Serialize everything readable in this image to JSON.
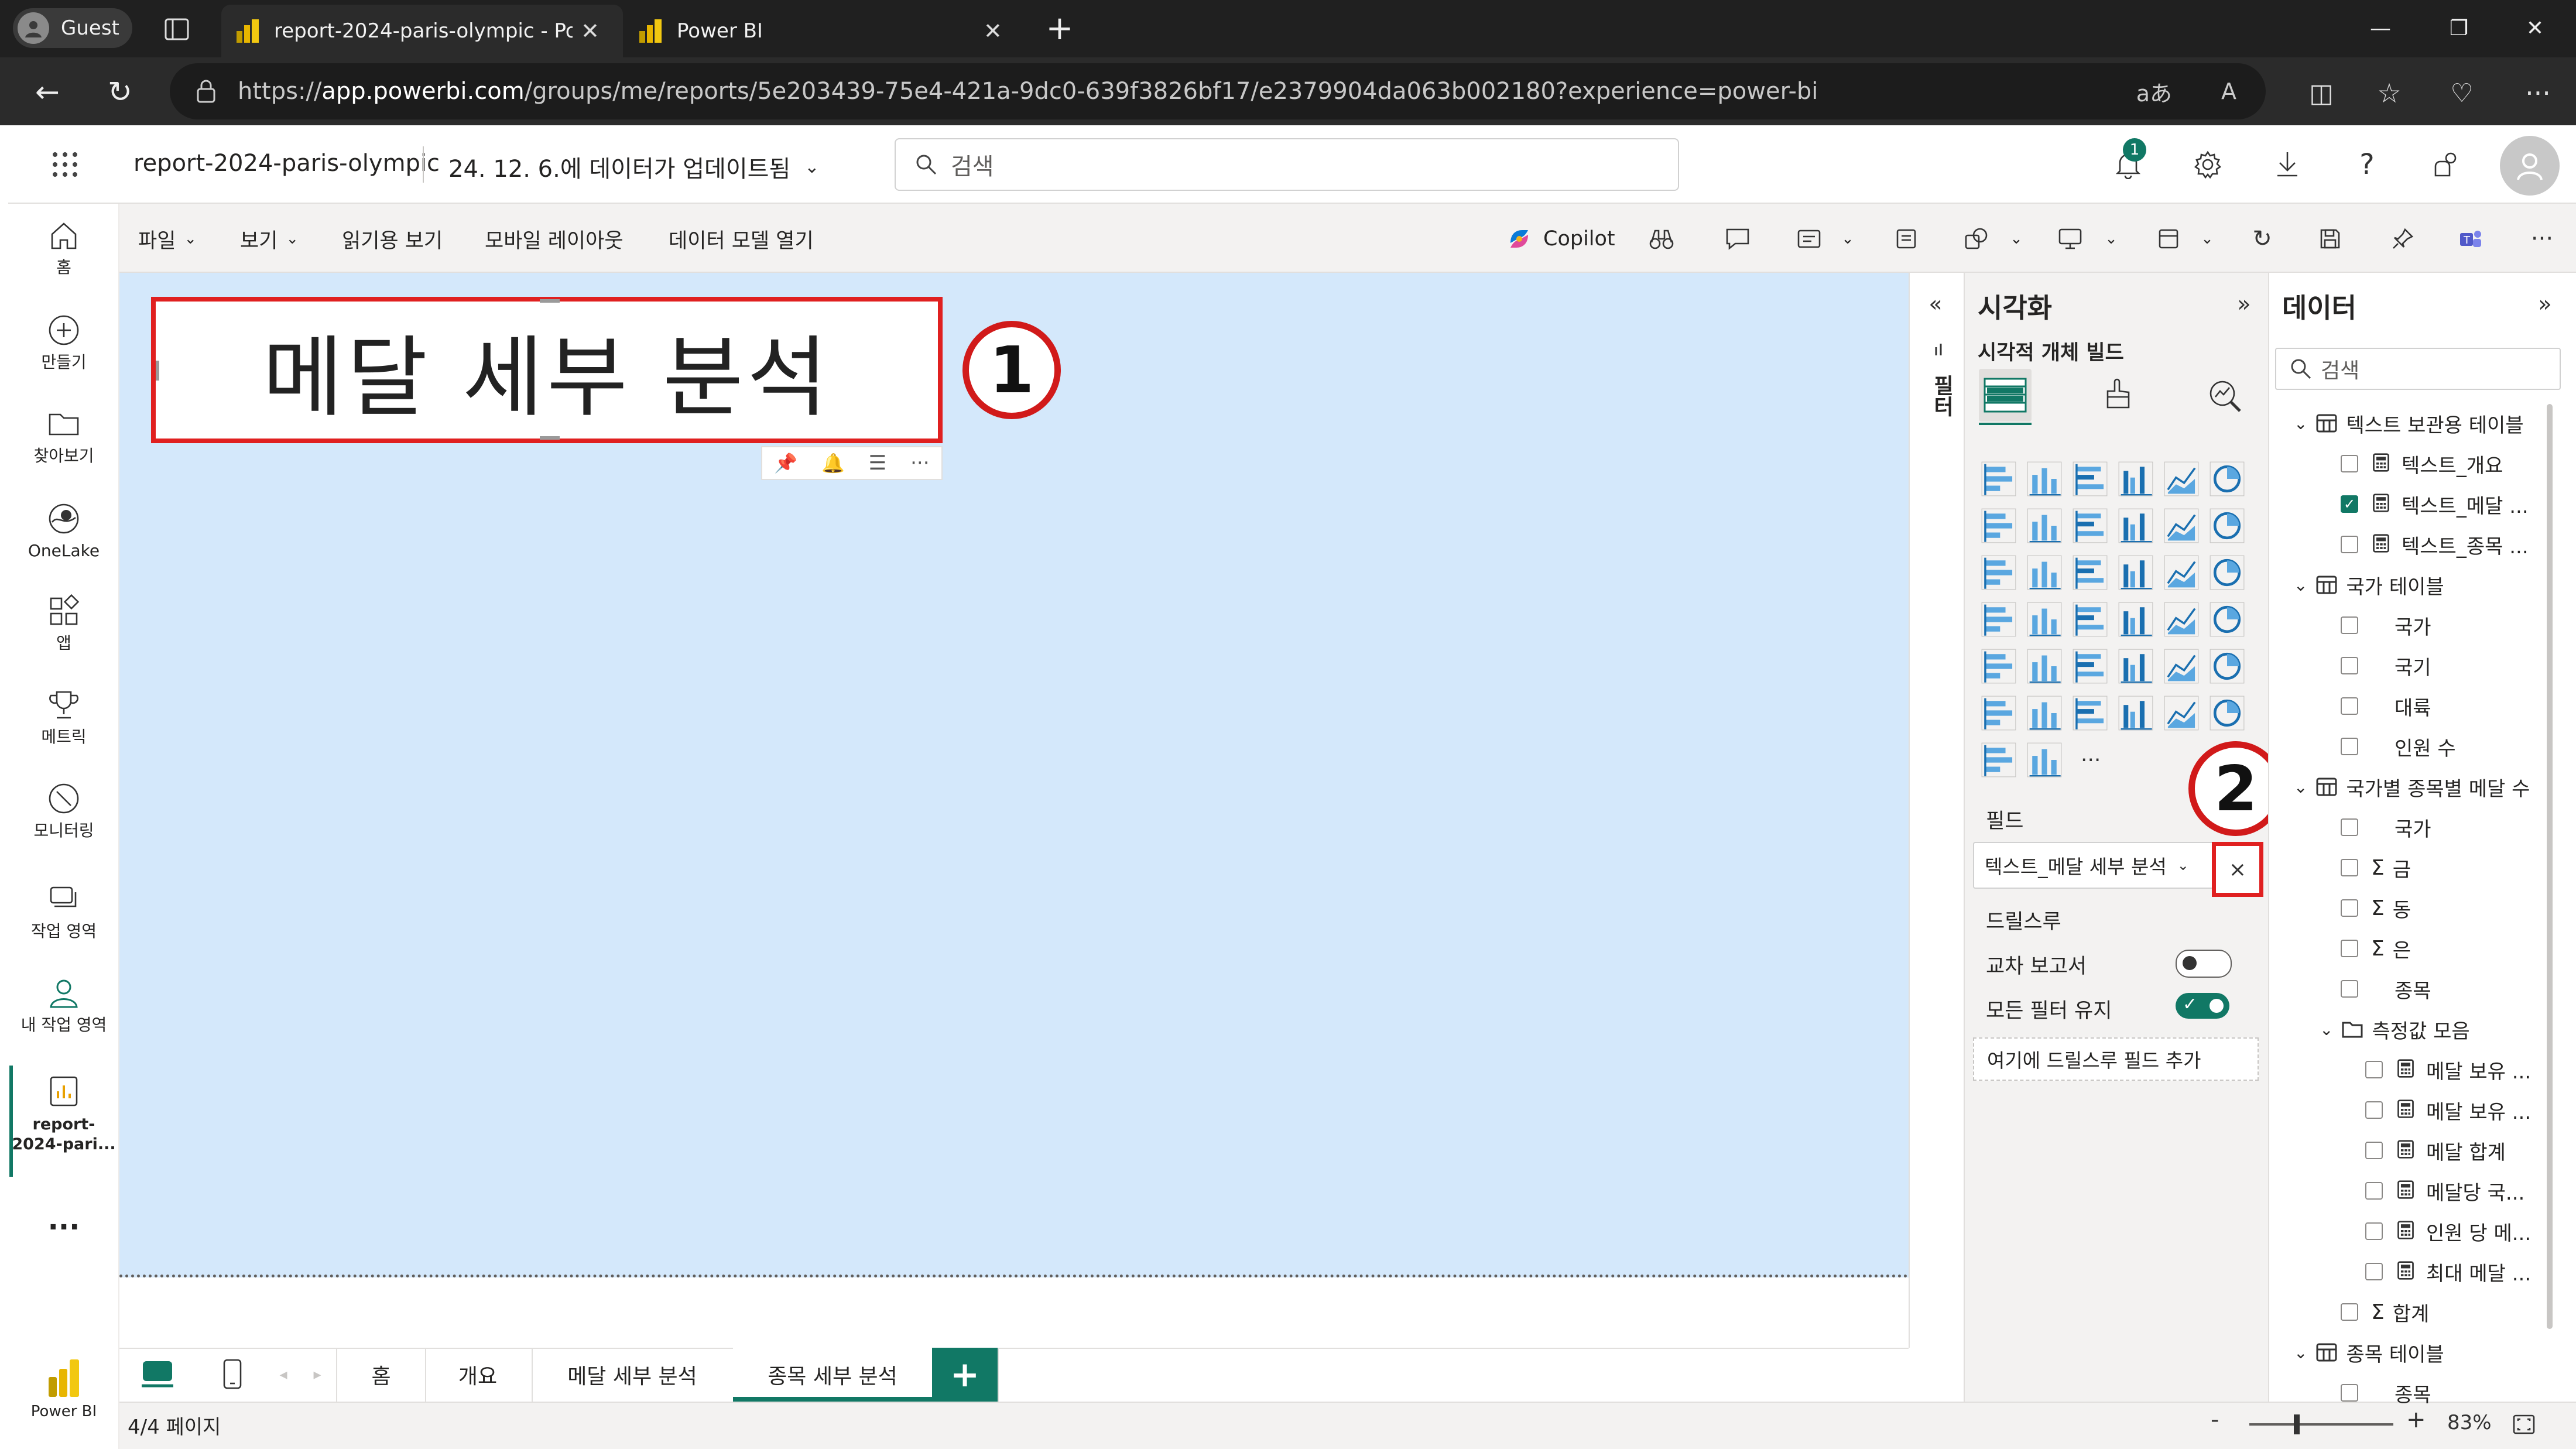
{
  "browser": {
    "profile": "Guest",
    "tabs": [
      {
        "title": "report-2024-paris-olympic - Powe",
        "active": true
      },
      {
        "title": "Power BI",
        "active": false
      }
    ],
    "url_prefix": "https://",
    "url_host": "app.powerbi.com",
    "url_path": "/groups/me/reports/5e203439-75e4-421a-9dc0-639f3826bf17/e2379904da063b002180?experience=power-bi"
  },
  "header": {
    "report_name": "report-2024-paris-olympic",
    "updated": "24. 12. 6.에 데이터가 업데이트됨",
    "search_placeholder": "검색",
    "notif_count": "1"
  },
  "rail": {
    "home": "홈",
    "create": "만들기",
    "browse": "찾아보기",
    "onelake": "OneLake",
    "apps": "앱",
    "metrics": "메트릭",
    "monitor": "모니터링",
    "workspaces": "작업 영역",
    "my_workspace": "내 작업 영역",
    "report_a": "report-",
    "report_b": "2024-pari...",
    "more": "...",
    "powerbi": "Power BI"
  },
  "menu": {
    "file": "파일",
    "view": "보기",
    "reading": "읽기용 보기",
    "mobile": "모바일 레이아웃",
    "datamodel": "데이터 모델 열기",
    "copilot": "Copilot"
  },
  "canvas": {
    "textbox_title": "메달 세부 분석",
    "annotation1": "1",
    "annotation2": "2"
  },
  "pages": {
    "tabs": [
      "홈",
      "개요",
      "메달 세부 분석",
      "종목 세부 분석"
    ],
    "active_index": 3,
    "add": "+",
    "page_indicator": "4/4 페이지",
    "zoom": "83%",
    "zoom_minus": "-",
    "zoom_plus": "+"
  },
  "filters": {
    "label": "필터"
  },
  "viz": {
    "title": "시각화",
    "subtitle": "시각적 개체 빌드",
    "more": "...",
    "fields_label": "필드",
    "field_value": "텍스트_메달 세부 분석",
    "field_remove": "×",
    "drill_label": "드릴스루",
    "cross_report": "교차 보고서",
    "keep_filters": "모든 필터 유지",
    "drill_add": "여기에 드릴스루 필드 추가"
  },
  "data": {
    "title": "데이터",
    "search_placeholder": "검색",
    "tables": [
      {
        "name": "텍스트 보관용 테이블",
        "fields": [
          {
            "name": "텍스트_개요",
            "checked": false,
            "icon": "calc"
          },
          {
            "name": "텍스트_메달 ...",
            "checked": true,
            "icon": "calc"
          },
          {
            "name": "텍스트_종목 ...",
            "checked": false,
            "icon": "calc"
          }
        ]
      },
      {
        "name": "국가 테이블",
        "fields": [
          {
            "name": "국가",
            "checked": false,
            "icon": "none"
          },
          {
            "name": "국기",
            "checked": false,
            "icon": "none"
          },
          {
            "name": "대륙",
            "checked": false,
            "icon": "none"
          },
          {
            "name": "인원 수",
            "checked": false,
            "icon": "none"
          }
        ]
      },
      {
        "name": "국가별 종목별 메달 수",
        "fields": [
          {
            "name": "국가",
            "checked": false,
            "icon": "none"
          },
          {
            "name": "금",
            "checked": false,
            "icon": "sigma"
          },
          {
            "name": "동",
            "checked": false,
            "icon": "sigma"
          },
          {
            "name": "은",
            "checked": false,
            "icon": "sigma"
          },
          {
            "name": "종목",
            "checked": false,
            "icon": "none"
          }
        ]
      },
      {
        "name": "측정값 모음",
        "folder": true,
        "fields": [
          {
            "name": "메달 보유 ...",
            "checked": false,
            "icon": "calc"
          },
          {
            "name": "메달 보유 ...",
            "checked": false,
            "icon": "calc"
          },
          {
            "name": "메달 합계",
            "checked": false,
            "icon": "calc"
          },
          {
            "name": "메달당 국...",
            "checked": false,
            "icon": "calc"
          },
          {
            "name": "인원 당 메...",
            "checked": false,
            "icon": "calc"
          },
          {
            "name": "최대 메달 ...",
            "checked": false,
            "icon": "calc"
          }
        ]
      },
      {
        "name": "합계",
        "single_sigma": true
      },
      {
        "name": "종목 테이블",
        "fields": [
          {
            "name": "종목",
            "checked": false,
            "icon": "none"
          }
        ]
      }
    ]
  },
  "colors": {
    "accent": "#117865",
    "annotation": "#d11a1a",
    "canvas": "#d4e8fb",
    "powerbi_yellow": "#f2c811"
  }
}
